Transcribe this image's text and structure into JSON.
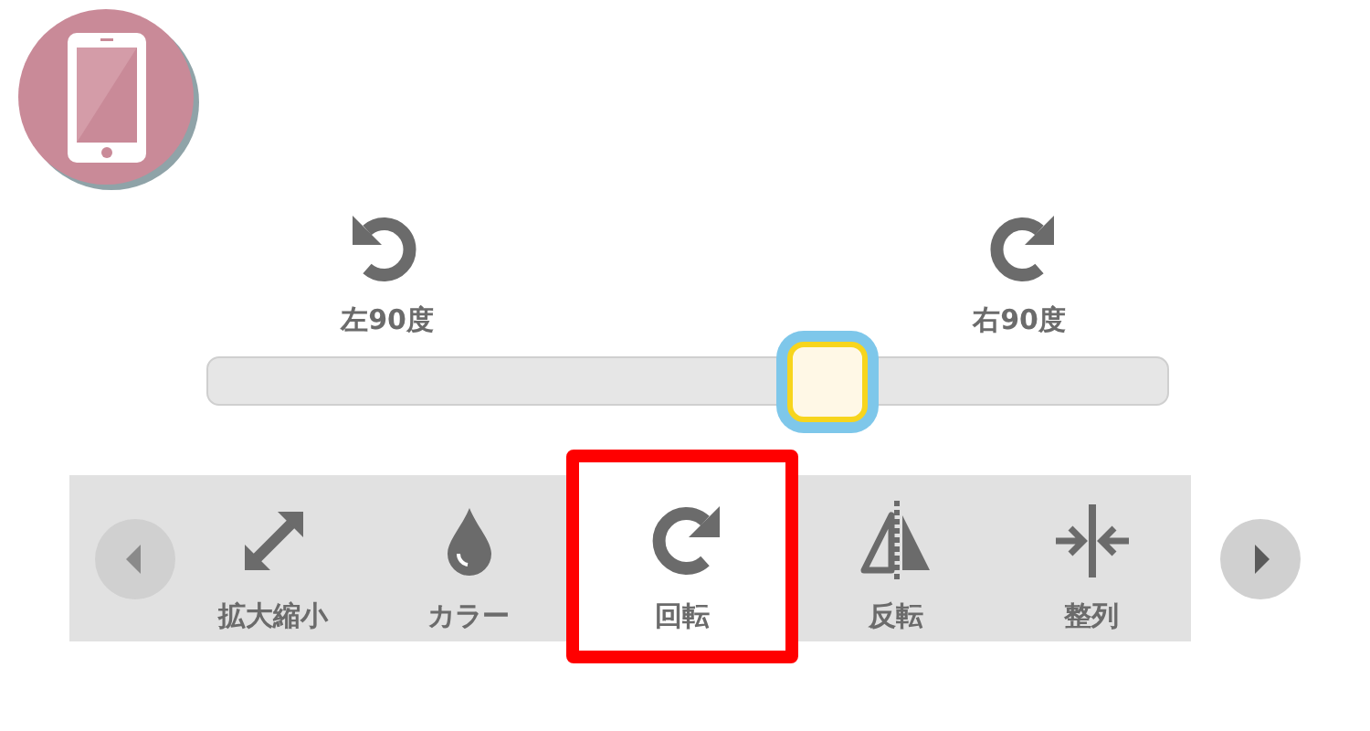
{
  "rotate_left": {
    "label": "左90度"
  },
  "rotate_right": {
    "label": "右90度"
  },
  "slider": {
    "level": 0.645
  },
  "toolbar": [
    {
      "label": "拡大縮小",
      "kind": "scale",
      "selected": false
    },
    {
      "label": "カラー",
      "kind": "color",
      "selected": false
    },
    {
      "label": "回転",
      "kind": "rotate",
      "selected": true
    },
    {
      "label": "反転",
      "kind": "flip",
      "selected": false
    },
    {
      "label": "整列",
      "kind": "align",
      "selected": false
    }
  ]
}
